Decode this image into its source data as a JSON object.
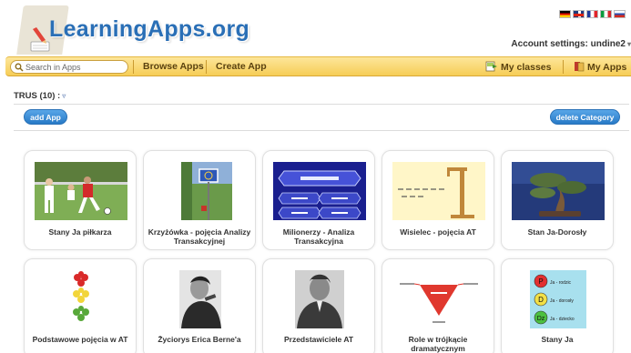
{
  "header": {
    "logo_text": "LearningApps.org",
    "account_label": "Account settings: undine2"
  },
  "languages": [
    "de",
    "en",
    "fr",
    "it",
    "ru"
  ],
  "nav": {
    "search_placeholder": "Search in Apps",
    "browse_apps": "Browse Apps",
    "create_app": "Create App",
    "my_classes": "My classes",
    "my_apps": "My Apps"
  },
  "category": {
    "label": "TRUS (10) :",
    "add_app": "add App",
    "delete_category": "delete Category"
  },
  "apps": [
    {
      "title": "Stany Ja piłkarza",
      "image": "football-players"
    },
    {
      "title": "Krzyżówka - pojęcia Analizy Transakcyjnej",
      "image": "road-sign"
    },
    {
      "title": "Milionerzy - Analiza Transakcyjna",
      "image": "millionaire-quiz"
    },
    {
      "title": "Wisielec - pojęcia AT",
      "image": "hangman"
    },
    {
      "title": "Stan Ja-Dorosły",
      "image": "bonsai-tree"
    },
    {
      "title": "Podstawowe pojęcia w AT",
      "image": "traffic-light"
    },
    {
      "title": "Życiorys Erica Berne'a",
      "image": "portrait-eric-berne"
    },
    {
      "title": "Przedstawiciele AT",
      "image": "portrait-man"
    },
    {
      "title": "Role w trójkącie dramatycznym",
      "image": "drama-triangle"
    },
    {
      "title": "Stany Ja",
      "image": "ego-states"
    }
  ],
  "ego_states": {
    "p": "P",
    "d": "D",
    "dz": "Dz",
    "p_label": "Ja - rodzic",
    "d_label": "Ja - dorosły",
    "dz_label": "Ja - dziecko"
  },
  "colors": {
    "brand_blue": "#2a6fb6",
    "nav_bar": "#f6cd56",
    "button_blue": "#2779c6"
  }
}
